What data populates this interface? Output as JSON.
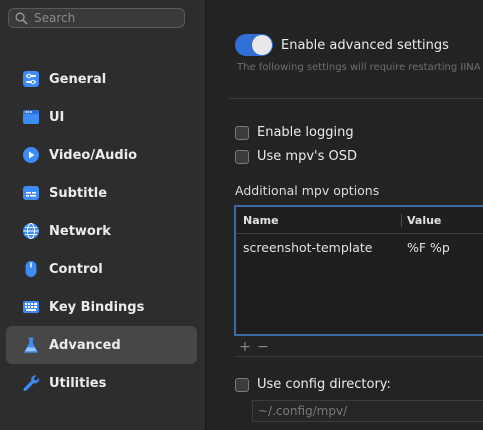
{
  "search": {
    "placeholder": "Search"
  },
  "sidebar": {
    "items": [
      {
        "label": "General",
        "icon": "general-icon"
      },
      {
        "label": "UI",
        "icon": "ui-icon"
      },
      {
        "label": "Video/Audio",
        "icon": "video-audio-icon"
      },
      {
        "label": "Subtitle",
        "icon": "subtitle-icon"
      },
      {
        "label": "Network",
        "icon": "network-icon"
      },
      {
        "label": "Control",
        "icon": "control-icon"
      },
      {
        "label": "Key Bindings",
        "icon": "key-bindings-icon"
      },
      {
        "label": "Advanced",
        "icon": "advanced-icon",
        "active": true
      },
      {
        "label": "Utilities",
        "icon": "utilities-icon"
      }
    ]
  },
  "advanced": {
    "toggle_label": "Enable advanced settings",
    "toggle_on": true,
    "note": "The following settings will require restarting IINA",
    "enable_logging": "Enable logging",
    "use_mpv_osd": "Use mpv's OSD",
    "mpv_options_label": "Additional mpv options",
    "table": {
      "columns": [
        "Name",
        "Value"
      ],
      "rows": [
        {
          "name": "screenshot-template",
          "value": "%F %p"
        }
      ]
    },
    "add_symbol": "+",
    "remove_symbol": "−",
    "use_config_dir": "Use config directory:",
    "config_dir_placeholder": "~/.config/mpv/"
  },
  "colors": {
    "accent": "#2f6fd6",
    "icon_blue": "#3d8bf7",
    "selection": "#474747"
  }
}
